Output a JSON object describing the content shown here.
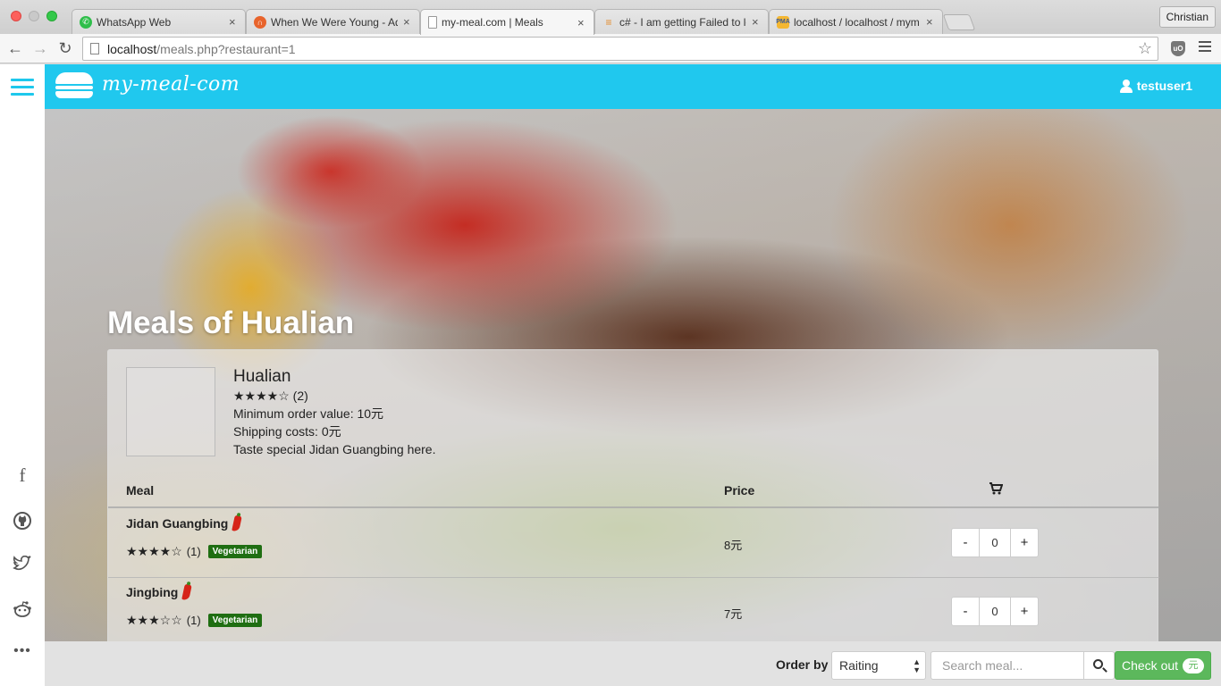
{
  "browser": {
    "tabs": [
      {
        "title": "WhatsApp Web",
        "icon": "whatsapp-icon"
      },
      {
        "title": "When We Were Young - Ad",
        "icon": "headphones-icon"
      },
      {
        "title": "my-meal.com | Meals",
        "icon": "page-icon"
      },
      {
        "title": "c# - I am getting Failed to lo",
        "icon": "stackoverflow-icon"
      },
      {
        "title": "localhost / localhost / mym",
        "icon": "phpmyadmin-icon"
      }
    ],
    "active_tab": 2,
    "profile": "Christian",
    "url_host": "localhost",
    "url_path": "/meals.php?restaurant=1"
  },
  "app": {
    "logo_text": "my-meal-com",
    "username": "testuser1",
    "accent_color": "#20c8ee"
  },
  "sidebar": {
    "social": [
      "facebook-icon",
      "github-icon",
      "twitter-icon",
      "reddit-icon",
      "more-icon"
    ]
  },
  "page": {
    "title": "Meals of Hualian"
  },
  "restaurant": {
    "name": "Hualian",
    "stars": "★★★★☆",
    "rating_count": "(2)",
    "min_order": "Minimum order value: 10元",
    "shipping": "Shipping costs: 0元",
    "description": "Taste special Jidan Guangbing here."
  },
  "table": {
    "headers": {
      "meal": "Meal",
      "price": "Price",
      "cart": "cart-icon"
    },
    "rows": [
      {
        "name": "Jidan Guangbing",
        "stars": "★★★★☆",
        "count": "(1)",
        "badge": "Vegetarian",
        "price": "8元",
        "qty": "0",
        "minus": "-",
        "plus": "+"
      },
      {
        "name": "Jingbing",
        "stars": "★★★☆☆",
        "count": "(1)",
        "badge": "Vegetarian",
        "price": "7元",
        "qty": "0",
        "minus": "-",
        "plus": "+"
      }
    ]
  },
  "order_bar": {
    "order_by_label": "Order by",
    "order_by_value": "Raiting",
    "search_placeholder": "Search meal...",
    "checkout_label": "Check out",
    "checkout_badge": "元"
  }
}
